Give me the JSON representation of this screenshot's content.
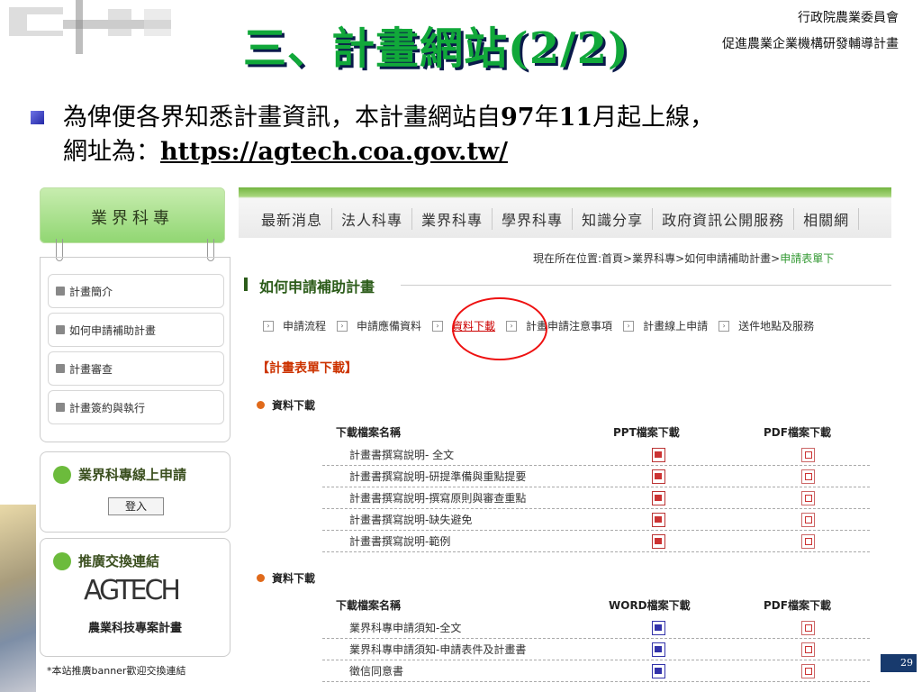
{
  "header": {
    "org_line1": "行政院農業委員會",
    "org_line2": "促進農業企業機構研發輔導計畫",
    "title": "三、計畫網站(2/2)"
  },
  "intro": {
    "text_a": "為俾便各界知悉計畫資訊，本計畫網站自",
    "year": "97",
    "text_b": "年",
    "month": "11",
    "text_c": "月起上線，",
    "text_d": "網址為：",
    "url": "https://agtech.coa.gov.tw/"
  },
  "site": {
    "side_header": "業界科專",
    "side_items": [
      "計畫簡介",
      "如何申請補助計畫",
      "計畫審查",
      "計畫簽約與執行"
    ],
    "apply_title": "業界科專線上申請",
    "login_label": "登入",
    "link_title": "推廣交換連結",
    "agtech_logo": "AGTECH",
    "agtech_sub": "農業科技專案計畫",
    "banner_note": "*本站推廣banner歡迎交換連結",
    "nav": [
      "最新消息",
      "法人科專",
      "業界科專",
      "學界科專",
      "知識分享",
      "政府資訊公開服務",
      "相關網"
    ],
    "breadcrumb_prefix": "現在所在位置:首頁>業界科專>如何申請補助計畫>",
    "breadcrumb_current": "申請表單下",
    "section_title": "如何申請補助計畫",
    "submenu": [
      "申請流程",
      "申請應備資料",
      "資料下載",
      "計畫申請注意事項",
      "計畫線上申請",
      "送件地點及服務"
    ],
    "form_title": "【計畫表單下載】",
    "dl1": {
      "label": "資料下載",
      "col_name": "下載檔案名稱",
      "col_a": "PPT檔案下載",
      "col_b": "PDF檔案下載",
      "rows": [
        "計畫書撰寫說明- 全文",
        "計畫書撰寫說明-研提準備與重點提要",
        "計畫書撰寫說明-撰寫原則與審查重點",
        "計畫書撰寫說明-缺失避免",
        "計畫書撰寫說明-範例"
      ]
    },
    "dl2": {
      "label": "資料下載",
      "col_name": "下載檔案名稱",
      "col_a": "WORD檔案下載",
      "col_b": "PDF檔案下載",
      "rows": [
        "業界科專申請須知-全文",
        "業界科專申請須知-申請表件及計畫書",
        "徵信同意書"
      ]
    }
  },
  "page_number": "29",
  "colors": {
    "title_green": "#11a83a",
    "title_shadow": "#0a1a4a",
    "page_box": "#183a6d",
    "ring": "#e11111"
  }
}
